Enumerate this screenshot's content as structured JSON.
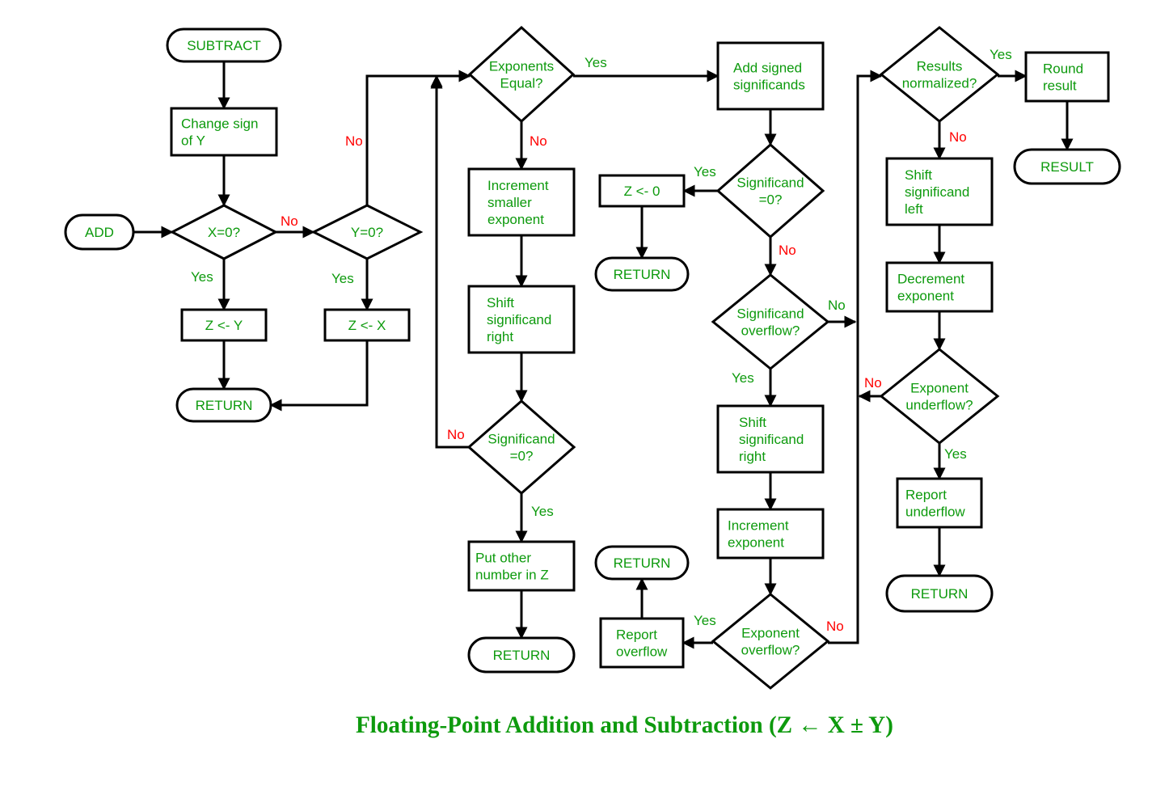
{
  "colors": {
    "text": "#0d9a0d",
    "no_label": "#ff0000",
    "yes_label": "#0d9a0d",
    "lines": "#000000"
  },
  "caption": "Floating-Point Addition and Subtraction (Z ← X ± Y)",
  "nodes": {
    "subtract": {
      "type": "terminal",
      "lines": [
        "SUBTRACT"
      ]
    },
    "change_sign": {
      "type": "process",
      "lines": [
        "Change sign",
        "of Y"
      ]
    },
    "add": {
      "type": "terminal",
      "lines": [
        "ADD"
      ]
    },
    "x_zero": {
      "type": "decision",
      "lines": [
        "X=0?"
      ]
    },
    "y_zero": {
      "type": "decision",
      "lines": [
        "Y=0?"
      ]
    },
    "z_gets_y": {
      "type": "process",
      "lines": [
        "Z <- Y"
      ]
    },
    "z_gets_x": {
      "type": "process",
      "lines": [
        "Z <- X"
      ]
    },
    "return_1": {
      "type": "terminal",
      "lines": [
        "RETURN"
      ]
    },
    "exponents_equal": {
      "type": "decision",
      "lines": [
        "Exponents",
        "Equal?"
      ]
    },
    "increment_smaller": {
      "type": "process",
      "lines": [
        "Increment",
        "smaller",
        "exponent"
      ]
    },
    "shift_right_1": {
      "type": "process",
      "lines": [
        "Shift",
        "significand",
        "right"
      ]
    },
    "significand_zero_1": {
      "type": "decision",
      "lines": [
        "Significand",
        "=0?"
      ]
    },
    "put_other": {
      "type": "process",
      "lines": [
        "Put  other",
        "number in Z"
      ]
    },
    "return_2": {
      "type": "terminal",
      "lines": [
        "RETURN"
      ]
    },
    "add_signed": {
      "type": "process",
      "lines": [
        "Add signed",
        "significands"
      ]
    },
    "significand_zero_2": {
      "type": "decision",
      "lines": [
        "Significand",
        "=0?"
      ]
    },
    "z_gets_0": {
      "type": "process",
      "lines": [
        "Z <- 0"
      ]
    },
    "return_3": {
      "type": "terminal",
      "lines": [
        "RETURN"
      ]
    },
    "significand_overflow": {
      "type": "decision",
      "lines": [
        "Significand",
        "overflow?"
      ]
    },
    "shift_right_2": {
      "type": "process",
      "lines": [
        "Shift",
        "significand",
        "right"
      ]
    },
    "increment_exponent": {
      "type": "process",
      "lines": [
        "Increment",
        "exponent"
      ]
    },
    "exponent_overflow": {
      "type": "decision",
      "lines": [
        "Exponent",
        "overflow?"
      ]
    },
    "report_overflow": {
      "type": "process",
      "lines": [
        "Report",
        "overflow"
      ]
    },
    "return_4": {
      "type": "terminal",
      "lines": [
        "RETURN"
      ]
    },
    "results_normalized": {
      "type": "decision",
      "lines": [
        "Results",
        "normalized?"
      ]
    },
    "round_result": {
      "type": "process",
      "lines": [
        "Round",
        "result"
      ]
    },
    "result": {
      "type": "terminal",
      "lines": [
        "RESULT"
      ]
    },
    "shift_left": {
      "type": "process",
      "lines": [
        "Shift",
        "significand",
        "left"
      ]
    },
    "decrement_exponent": {
      "type": "process",
      "lines": [
        "Decrement",
        "exponent"
      ]
    },
    "exponent_underflow": {
      "type": "decision",
      "lines": [
        "Exponent",
        "underflow?"
      ]
    },
    "report_underflow": {
      "type": "process",
      "lines": [
        "Report",
        "underflow"
      ]
    },
    "return_5": {
      "type": "terminal",
      "lines": [
        "RETURN"
      ]
    }
  },
  "edge_labels": {
    "x_zero_no": {
      "text": "No",
      "kind": "no"
    },
    "x_zero_yes": {
      "text": "Yes",
      "kind": "yes"
    },
    "y_zero_no": {
      "text": "No",
      "kind": "no"
    },
    "y_zero_yes": {
      "text": "Yes",
      "kind": "yes"
    },
    "exponents_equal_yes": {
      "text": "Yes",
      "kind": "yes"
    },
    "exponents_equal_no": {
      "text": "No",
      "kind": "no"
    },
    "significand_zero_1_no": {
      "text": "No",
      "kind": "no"
    },
    "significand_zero_1_yes": {
      "text": "Yes",
      "kind": "yes"
    },
    "significand_zero_2_yes": {
      "text": "Yes",
      "kind": "yes"
    },
    "significand_zero_2_no": {
      "text": "No",
      "kind": "no"
    },
    "significand_overflow_no": {
      "text": "No",
      "kind": "yes"
    },
    "significand_overflow_yes": {
      "text": "Yes",
      "kind": "yes"
    },
    "exponent_overflow_yes": {
      "text": "Yes",
      "kind": "yes"
    },
    "exponent_overflow_no": {
      "text": "No",
      "kind": "no"
    },
    "results_normalized_yes": {
      "text": "Yes",
      "kind": "yes"
    },
    "results_normalized_no": {
      "text": "No",
      "kind": "no"
    },
    "exponent_underflow_no": {
      "text": "No",
      "kind": "no"
    },
    "exponent_underflow_yes": {
      "text": "Yes",
      "kind": "yes"
    }
  }
}
